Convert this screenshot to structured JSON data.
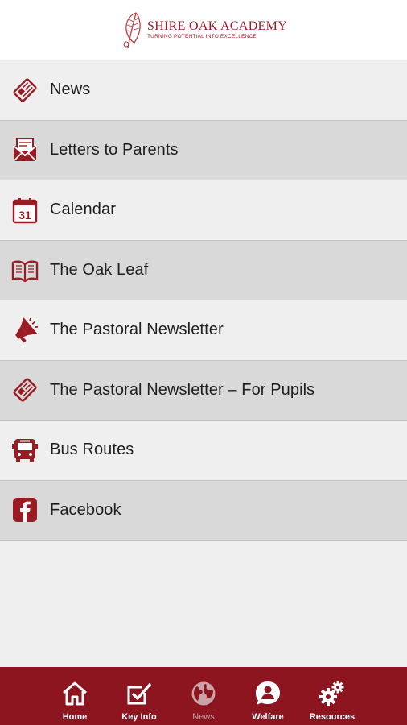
{
  "header": {
    "school_name": "SHIRE OAK ACADEMY",
    "tagline": "TURNING POTENTIAL INTO EXCELLENCE"
  },
  "menu": [
    {
      "label": "News",
      "icon": "newspaper-icon"
    },
    {
      "label": "Letters to Parents",
      "icon": "envelope-letter-icon"
    },
    {
      "label": "Calendar",
      "icon": "calendar-icon",
      "icon_text": "31"
    },
    {
      "label": "The Oak Leaf",
      "icon": "open-book-icon"
    },
    {
      "label": "The Pastoral Newsletter",
      "icon": "megaphone-icon"
    },
    {
      "label": "The Pastoral Newsletter – For Pupils",
      "icon": "newspaper-icon"
    },
    {
      "label": "Bus Routes",
      "icon": "bus-icon"
    },
    {
      "label": "Facebook",
      "icon": "facebook-icon"
    }
  ],
  "tabs": [
    {
      "label": "Home",
      "icon": "home-icon"
    },
    {
      "label": "Key Info",
      "icon": "checkbox-icon"
    },
    {
      "label": "News",
      "icon": "globe-icon",
      "active": true
    },
    {
      "label": "Welfare",
      "icon": "user-bubble-icon"
    },
    {
      "label": "Resources",
      "icon": "gears-icon"
    }
  ],
  "colors": {
    "brand": "#8c1520",
    "icon": "#9b1b24",
    "row_light": "#efefef",
    "row_dark": "#d9d9d9"
  }
}
